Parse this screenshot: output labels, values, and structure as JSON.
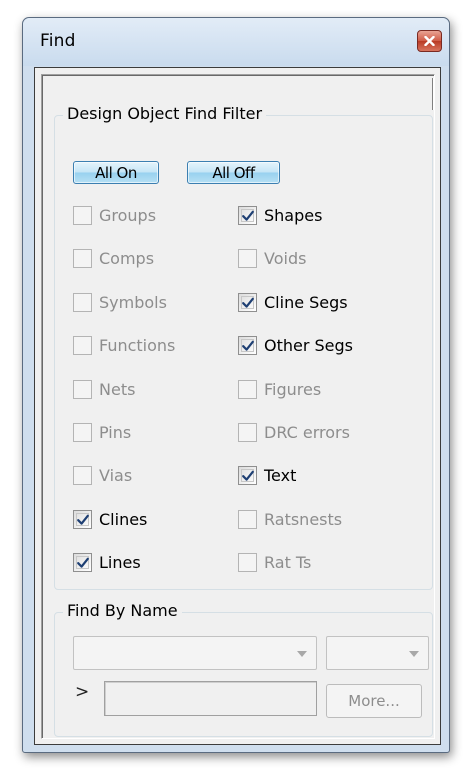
{
  "window": {
    "title": "Find",
    "close_icon": "close-x-icon"
  },
  "filter": {
    "legend": "Design Object Find Filter",
    "all_on_label": "All On",
    "all_off_label": "All Off",
    "left_column": [
      {
        "label": "Groups",
        "checked": false,
        "enabled": false
      },
      {
        "label": "Comps",
        "checked": false,
        "enabled": false
      },
      {
        "label": "Symbols",
        "checked": false,
        "enabled": false
      },
      {
        "label": "Functions",
        "checked": false,
        "enabled": false
      },
      {
        "label": "Nets",
        "checked": false,
        "enabled": false
      },
      {
        "label": "Pins",
        "checked": false,
        "enabled": false
      },
      {
        "label": "Vias",
        "checked": false,
        "enabled": false
      },
      {
        "label": "Clines",
        "checked": true,
        "enabled": true
      },
      {
        "label": "Lines",
        "checked": true,
        "enabled": true
      }
    ],
    "right_column": [
      {
        "label": "Shapes",
        "checked": true,
        "enabled": true
      },
      {
        "label": "Voids",
        "checked": false,
        "enabled": false
      },
      {
        "label": "Cline Segs",
        "checked": true,
        "enabled": true
      },
      {
        "label": "Other Segs",
        "checked": true,
        "enabled": true
      },
      {
        "label": "Figures",
        "checked": false,
        "enabled": false
      },
      {
        "label": "DRC errors",
        "checked": false,
        "enabled": false
      },
      {
        "label": "Text",
        "checked": true,
        "enabled": true
      },
      {
        "label": "Ratsnests",
        "checked": false,
        "enabled": false
      },
      {
        "label": "Rat Ts",
        "checked": false,
        "enabled": false
      }
    ]
  },
  "find_by_name": {
    "legend": "Find By Name",
    "name_combo_value": "",
    "type_combo_value": "",
    "prompt_symbol": ">",
    "name_input_value": "",
    "more_label": "More..."
  },
  "colors": {
    "title_bar": "#cfdeee",
    "client_bg": "#f0f0f0",
    "toggle_button": "#b6e0f4",
    "check_mark": "#1e3f73",
    "disabled_text": "#8d8d8d"
  }
}
